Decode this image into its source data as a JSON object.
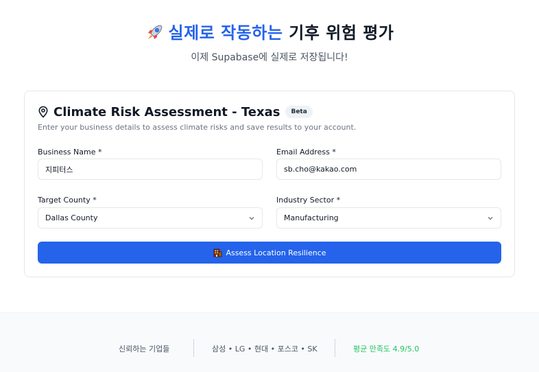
{
  "hero": {
    "title_accent": "실제로 작동하는",
    "title_rest": "기후 위험 평가",
    "subtitle": "이제 Supabase에 실제로 저장됩니다!",
    "icon": "rocket-icon"
  },
  "card": {
    "icon": "map-pin-icon",
    "title": "Climate Risk Assessment - Texas",
    "badge": "Beta",
    "description": "Enter your business details to assess climate risks and save results to your account."
  },
  "form": {
    "business_name": {
      "label": "Business Name *",
      "value": "지피터스"
    },
    "email": {
      "label": "Email Address *",
      "value": "sb.cho@kakao.com"
    },
    "county": {
      "label": "Target County *",
      "value": "Dallas County"
    },
    "sector": {
      "label": "Industry Sector *",
      "value": "Manufacturing"
    },
    "submit_label": "Assess Location Resilience",
    "submit_icon": "building-icon"
  },
  "footer": {
    "trusted": "신뢰하는 기업들",
    "brands": "삼성 • LG • 현대 • 포스코 • SK",
    "rating": "평균 만족도 4.9/5.0"
  },
  "colors": {
    "accent": "#2563eb",
    "rating": "#22c55e"
  }
}
